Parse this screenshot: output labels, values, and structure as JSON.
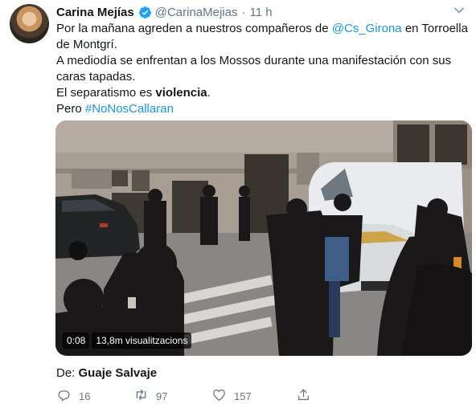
{
  "tweet": {
    "author": {
      "name": "Carina Mejías",
      "handle": "@CarinaMejias"
    },
    "separator": "·",
    "time": "11 h",
    "text": {
      "line1_pre": "Por la mañana agreden a nuestros compañeros de ",
      "line1_mention": "@Cs_Girona",
      "line1_post": " en Torroella de Montgrí.",
      "line2": "A mediodía se enfrentan a los Mossos durante una manifestación con sus caras tapadas.",
      "line3_pre": "El separatismo es ",
      "line3_bold": "violencia",
      "line3_post": ".",
      "line4_pre": "Pero ",
      "line4_hashtag": "#NoNosCallaran"
    },
    "media": {
      "duration": "0:08",
      "views": "13,8m visualitzacions"
    },
    "credit": {
      "prefix": "De: ",
      "author": "Guaje Salvaje"
    },
    "actions": {
      "replies": "16",
      "retweets": "97",
      "likes": "157"
    }
  },
  "icons": {
    "verified": "verified-badge-icon",
    "more": "chevron-down-icon",
    "reply": "reply-icon",
    "retweet": "retweet-icon",
    "like": "heart-icon",
    "share": "share-icon"
  },
  "colors": {
    "link": "#1b95e0",
    "muted": "#657786",
    "text": "#14171a"
  }
}
